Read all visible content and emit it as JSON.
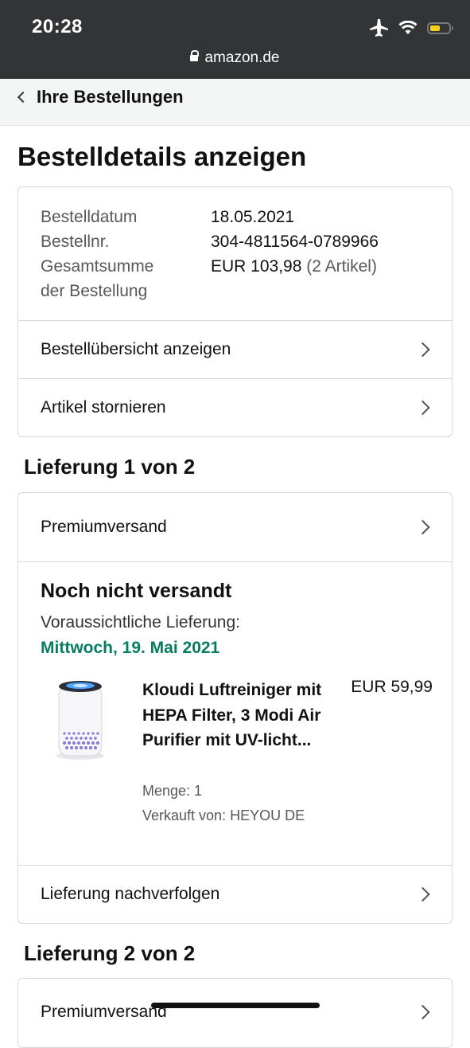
{
  "status_bar": {
    "time": "20:28",
    "url": "amazon.de",
    "battery_color": "#f6d11c"
  },
  "nav": {
    "back_label": "Ihre Bestellungen"
  },
  "page_title": "Bestelldetails anzeigen",
  "order": {
    "date_label": "Bestelldatum",
    "date_value": "18.05.2021",
    "number_label": "Bestellnr.",
    "number_value": "304-4811564-0789966",
    "total_label_1": "Gesamtsumme",
    "total_label_2": "der Bestellung",
    "total_value": "EUR 103,98",
    "total_count": "(2 Artikel)"
  },
  "order_links": {
    "overview": "Bestellübersicht anzeigen",
    "cancel": "Artikel stornieren"
  },
  "shipment1": {
    "title": "Lieferung 1 von 2",
    "method": "Premiumversand",
    "status": "Noch nicht versandt",
    "eta_label": "Voraussichtliche Lieferung:",
    "eta_date": "Mittwoch, 19. Mai 2021",
    "eta_color": "#067d62",
    "product": {
      "title": "Kloudi Luftreiniger mit HEPA Filter, 3 Modi Air Purifier mit UV-licht...",
      "price": "EUR 59,99",
      "quantity": "Menge: 1",
      "seller": "Verkauft von: HEYOU DE"
    },
    "track": "Lieferung nachverfolgen"
  },
  "shipment2": {
    "title": "Lieferung 2 von 2",
    "method": "Premiumversand"
  }
}
